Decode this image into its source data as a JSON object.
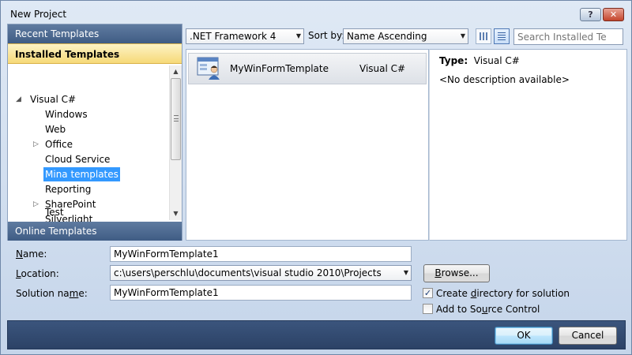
{
  "window": {
    "title": "New Project"
  },
  "categories": {
    "recent": "Recent Templates",
    "installed": "Installed Templates",
    "online": "Online Templates"
  },
  "tree": {
    "root": "Visual C#",
    "items": [
      "Windows",
      "Web",
      "Office",
      "Cloud Service",
      "Mina templates",
      "Reporting",
      "SharePoint",
      "Silverlight",
      "Test"
    ],
    "selected": "Mina templates"
  },
  "toolbar": {
    "framework": ".NET Framework 4",
    "sort_label": "Sort by:",
    "sort_value": "Name Ascending",
    "search_placeholder": "Search Installed Tem"
  },
  "templates": [
    {
      "name": "MyWinFormTemplate",
      "language": "Visual C#"
    }
  ],
  "description": {
    "type_label": "Type:",
    "type_value": "Visual C#",
    "text": "<No description available>"
  },
  "form": {
    "name_label_ul": "N",
    "name_label_rest": "ame:",
    "name_value": "MyWinFormTemplate1",
    "location_label_ul": "L",
    "location_label_rest": "ocation:",
    "location_value": "c:\\users\\perschlu\\documents\\visual studio 2010\\Projects",
    "solution_label_pre": "Solution na",
    "solution_label_ul": "m",
    "solution_label_post": "e:",
    "solution_value": "MyWinFormTemplate1",
    "browse_label_ul": "B",
    "browse_label_rest": "rowse...",
    "create_dir_pre": "Create ",
    "create_dir_ul": "d",
    "create_dir_post": "irectory for solution",
    "create_dir_checked": true,
    "source_control_pre": "Add to So",
    "source_control_ul": "u",
    "source_control_post": "rce Control",
    "source_control_checked": false
  },
  "buttons": {
    "ok": "OK",
    "cancel": "Cancel"
  }
}
